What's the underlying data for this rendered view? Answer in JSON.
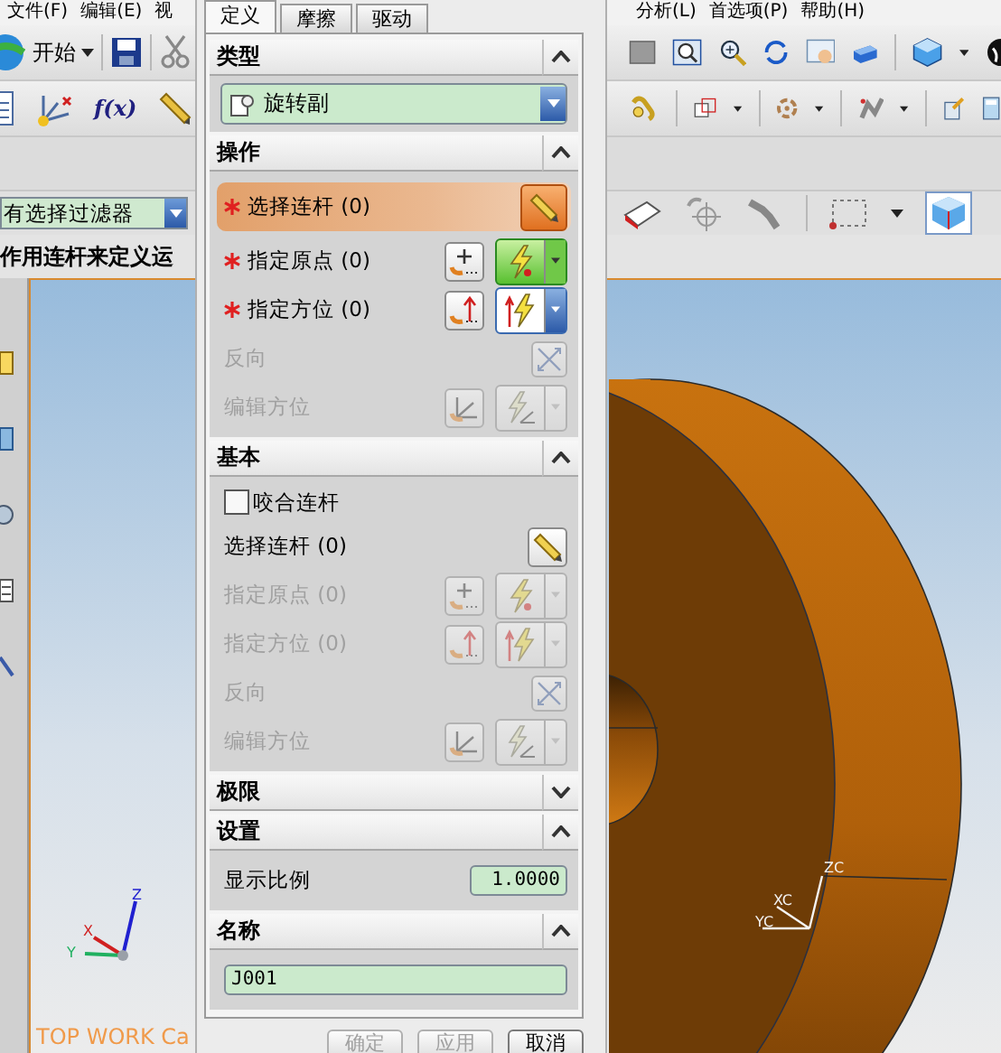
{
  "menu_bar": {
    "left": [
      {
        "label": "文件(F)"
      },
      {
        "label": "编辑(E)"
      },
      {
        "label": "视"
      }
    ],
    "right": [
      {
        "label": "分析(L)"
      },
      {
        "label": "首选项(P)"
      },
      {
        "label": "帮助(H)"
      }
    ]
  },
  "toolbar": {
    "start_label": "开始",
    "formula_label": "f(x)"
  },
  "selection_filter": {
    "value": "有选择过滤器"
  },
  "cue_line": "作用连杆来定义运",
  "viewport": {
    "view_label": "TOP WORK Ca",
    "absolute_axes": [
      "Z",
      "X",
      "Y"
    ],
    "work_axes": [
      "ZC",
      "XC",
      "YC"
    ]
  },
  "dialog": {
    "tabs": [
      {
        "label": "定义",
        "selected": true
      },
      {
        "label": "摩擦",
        "selected": false
      },
      {
        "label": "驱动",
        "selected": false
      }
    ],
    "sections": [
      {
        "title": "类型",
        "expanded": true,
        "items": [
          {
            "kind": "dropdown",
            "value": "旋转副"
          }
        ]
      },
      {
        "title": "操作",
        "expanded": true,
        "items": [
          {
            "kind": "link",
            "label": "选择连杆 (0)",
            "required": true,
            "active": true,
            "disabled": false
          },
          {
            "kind": "origin",
            "label": "指定原点 (0)",
            "required": true,
            "active": false,
            "disabled": false
          },
          {
            "kind": "vector",
            "label": "指定方位 (0)",
            "required": true,
            "active": false,
            "disabled": false
          },
          {
            "kind": "reverse",
            "label": "反向",
            "required": false,
            "active": false,
            "disabled": true
          },
          {
            "kind": "orient",
            "label": "编辑方位",
            "required": false,
            "active": false,
            "disabled": true
          }
        ]
      },
      {
        "title": "基本",
        "expanded": true,
        "items": [
          {
            "kind": "checkbox",
            "label": "咬合连杆",
            "checked": false
          },
          {
            "kind": "link",
            "label": "选择连杆 (0)",
            "required": false,
            "active": false,
            "disabled": false
          },
          {
            "kind": "origin",
            "label": "指定原点 (0)",
            "required": false,
            "active": false,
            "disabled": true
          },
          {
            "kind": "vector",
            "label": "指定方位 (0)",
            "required": false,
            "active": false,
            "disabled": true
          },
          {
            "kind": "reverse",
            "label": "反向",
            "required": false,
            "active": false,
            "disabled": true
          },
          {
            "kind": "orient",
            "label": "编辑方位",
            "required": false,
            "active": false,
            "disabled": true
          }
        ]
      },
      {
        "title": "极限",
        "expanded": false
      },
      {
        "title": "设置",
        "expanded": true,
        "items": [
          {
            "kind": "number",
            "label": "显示比例",
            "value": "1.0000"
          }
        ]
      },
      {
        "title": "名称",
        "expanded": true,
        "items": [
          {
            "kind": "text",
            "value": "J001"
          }
        ]
      }
    ],
    "buttons": [
      {
        "label": "确定",
        "disabled": true
      },
      {
        "label": "应用",
        "disabled": true
      },
      {
        "label": "取消",
        "disabled": false
      }
    ]
  }
}
